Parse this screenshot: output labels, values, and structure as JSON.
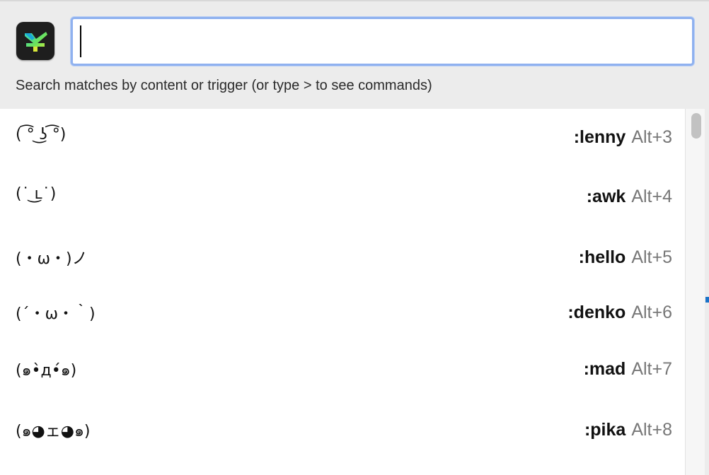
{
  "search": {
    "value": "",
    "hint": "Search matches by content or trigger (or type > to see commands)"
  },
  "app": {
    "icon": "espanso-app-icon",
    "accent": "#8fb1ef"
  },
  "matches": [
    {
      "content": "( ͡° ͜ʖ ͡°)",
      "trigger": ":lenny",
      "shortcut": "Alt+3"
    },
    {
      "content": "(˙ ͜ʟ˙)",
      "trigger": ":awk",
      "shortcut": "Alt+4"
    },
    {
      "content": "(・ω・)ノ",
      "trigger": ":hello",
      "shortcut": "Alt+5"
    },
    {
      "content": "(´・ω・｀)",
      "trigger": ":denko",
      "shortcut": "Alt+6"
    },
    {
      "content": "(๑•̀д•́๑)",
      "trigger": ":mad",
      "shortcut": "Alt+7"
    },
    {
      "content": "(๑◕ェ◕๑)",
      "trigger": ":pika",
      "shortcut": "Alt+8"
    }
  ],
  "colors": {
    "header_bg": "#ececec",
    "list_bg": "#ffffff",
    "shortcut_text": "#777777"
  }
}
